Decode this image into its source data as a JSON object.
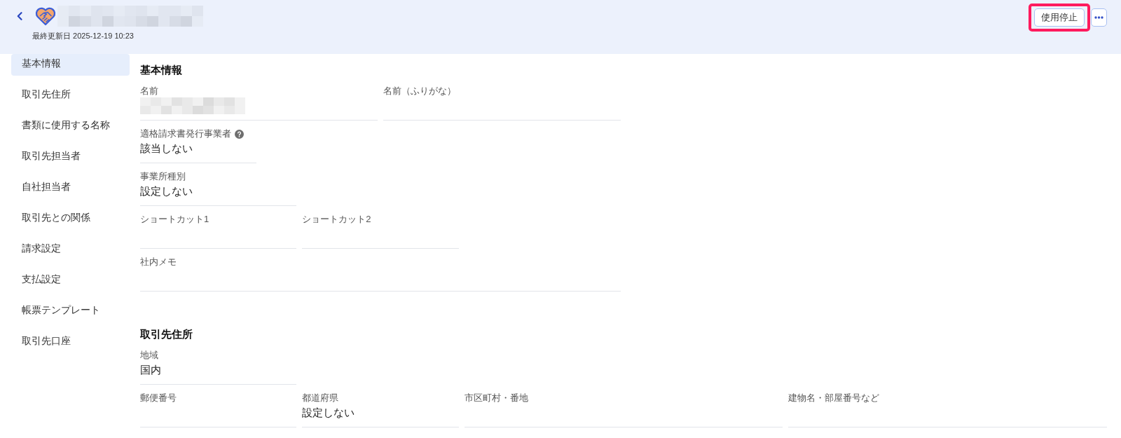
{
  "header": {
    "title_redacted": true,
    "updated": "最終更新日 2025-12-19 10:23",
    "actions": [
      {
        "kind": "button",
        "label": "使用停止",
        "highlighted": true
      },
      {
        "kind": "more",
        "highlighted": false
      }
    ]
  },
  "sidebar": {
    "items": [
      {
        "label": "基本情報",
        "selected": true
      },
      {
        "label": "取引先住所",
        "selected": false
      },
      {
        "label": "書類に使用する名称",
        "selected": false
      },
      {
        "label": "取引先担当者",
        "selected": false
      },
      {
        "label": "自社担当者",
        "selected": false
      },
      {
        "label": "取引先との関係",
        "selected": false
      },
      {
        "label": "請求設定",
        "selected": false
      },
      {
        "label": "支払設定",
        "selected": false
      },
      {
        "label": "帳票テンプレート",
        "selected": false
      },
      {
        "label": "取引先口座",
        "selected": false
      }
    ]
  },
  "sections": [
    {
      "title": "基本情報",
      "rows": [
        [
          {
            "label": "名前",
            "help": false,
            "redacted": true
          },
          {
            "label": "名前（ふりがな）",
            "help": false,
            "redacted": false
          }
        ],
        [
          {
            "label": "適格請求書発行事業者",
            "help": true,
            "redacted": false,
            "value": "該当しない"
          }
        ],
        [
          {
            "label": "事業所種別",
            "help": false,
            "redacted": false,
            "value": "設定しない"
          }
        ],
        [
          {
            "label": "ショートカット1",
            "help": false,
            "redacted": false
          },
          {
            "label": "ショートカット2",
            "help": false,
            "redacted": false
          }
        ],
        [
          {
            "label": "社内メモ",
            "help": false,
            "redacted": false
          }
        ]
      ]
    },
    {
      "title": "取引先住所",
      "rows": [
        [
          {
            "label": "地域",
            "help": false,
            "redacted": false,
            "value": "国内"
          }
        ],
        [
          {
            "label": "郵便番号",
            "help": false,
            "redacted": false
          },
          {
            "label": "都道府県",
            "help": false,
            "redacted": false,
            "value": "設定しない"
          },
          {
            "label": "市区町村・番地",
            "help": false,
            "redacted": false
          },
          {
            "label": "建物名・部屋番号など",
            "help": false,
            "redacted": false
          }
        ]
      ]
    }
  ]
}
